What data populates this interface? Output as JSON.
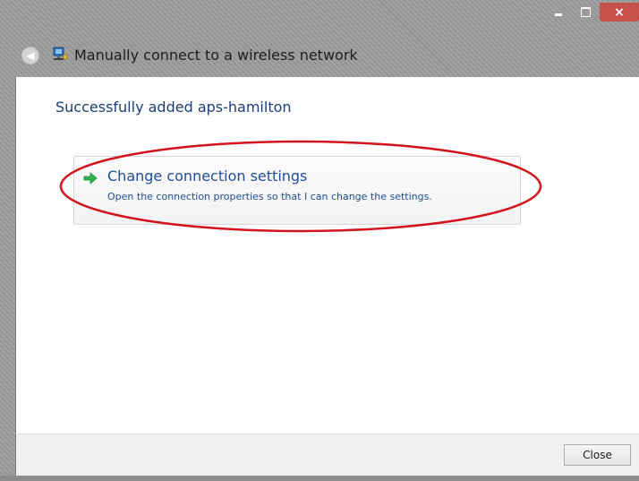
{
  "window": {
    "title": "Manually connect to a wireless network",
    "controls": {
      "minimize_icon": "minimize-icon",
      "maximize_icon": "maximize-icon",
      "close_glyph": "×"
    }
  },
  "header": {
    "back_icon": "back-arrow-icon",
    "back_glyph": "◀",
    "network_icon": "network-icon"
  },
  "main": {
    "heading": "Successfully added aps-hamilton",
    "option": {
      "icon": "green-arrow-icon",
      "title": "Change connection settings",
      "description": "Open the connection properties so that I can change the settings."
    },
    "annotation_color": "#d4121c"
  },
  "footer": {
    "close_label": "Close"
  },
  "colors": {
    "title_close_button": "#c7504a",
    "heading_text": "#1b3f78",
    "link_text": "#1e4d9b",
    "arrow_green": "#2db34a"
  }
}
